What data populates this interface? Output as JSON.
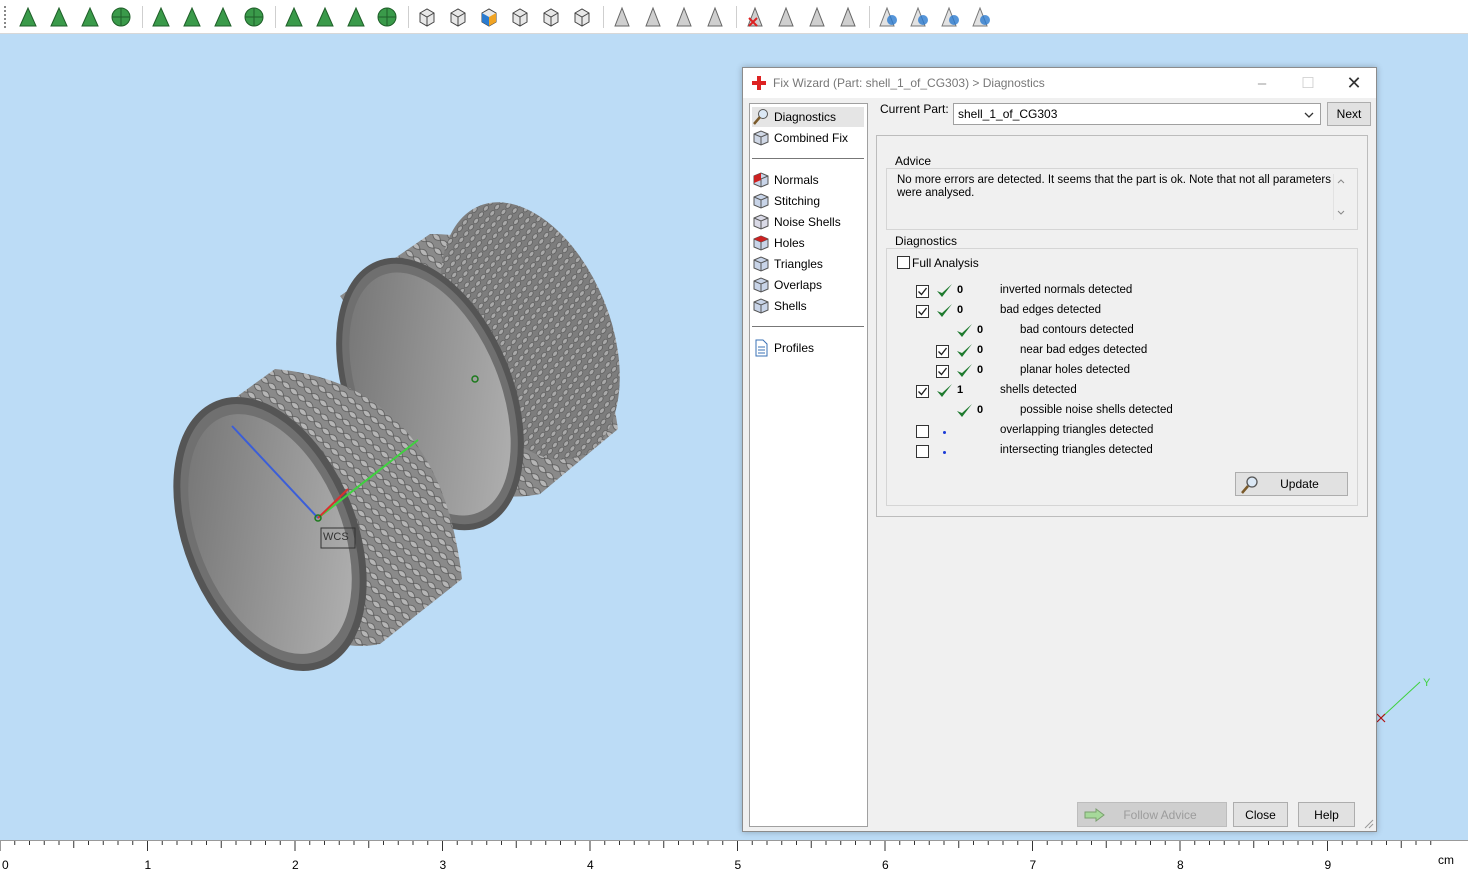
{
  "toolbar": {
    "icons": [
      "select-arrow-icon",
      "select-surface-icon",
      "select-edge-icon",
      "select-shell-icon",
      "rectangle-select-icon",
      "lasso-select-icon",
      "curve-select-icon",
      "mesh-select-icon",
      "grow-select-icon",
      "triangle-select-icon",
      "sphere-select-icon",
      "brush-select-icon",
      "view-front-icon",
      "view-back-icon",
      "view-left-icon",
      "view-right-icon",
      "view-top-icon",
      "view-iso-icon",
      "measure-icon",
      "cut-icon",
      "fill-icon",
      "analyze-icon",
      "delete-icon",
      "extrude-icon",
      "offset-icon",
      "smooth-icon",
      "hide-icon",
      "unhide-icon",
      "info-icon",
      "settings-icon"
    ]
  },
  "viewport": {
    "wcs_label": "WCS",
    "axis_y_label": "Y"
  },
  "ruler": {
    "labels": [
      "0",
      "1",
      "2",
      "3",
      "4",
      "5",
      "6",
      "7",
      "8",
      "9"
    ],
    "unit": "cm"
  },
  "dialog": {
    "title": "Fix Wizard (Part: shell_1_of_CG303) > Diagnostics",
    "nav": {
      "top": [
        {
          "label": "Diagnostics",
          "icon": "magnifier-icon",
          "selected": true
        },
        {
          "label": "Combined Fix",
          "icon": "combined-fix-icon"
        }
      ],
      "middle": [
        {
          "label": "Normals",
          "icon": "normals-icon"
        },
        {
          "label": "Stitching",
          "icon": "stitching-icon"
        },
        {
          "label": "Noise Shells",
          "icon": "noise-shells-icon"
        },
        {
          "label": "Holes",
          "icon": "holes-icon"
        },
        {
          "label": "Triangles",
          "icon": "triangles-icon"
        },
        {
          "label": "Overlaps",
          "icon": "overlaps-icon"
        },
        {
          "label": "Shells",
          "icon": "shells-icon"
        }
      ],
      "bottom": [
        {
          "label": "Profiles",
          "icon": "profiles-icon"
        }
      ]
    },
    "current_part_label": "Current Part:",
    "current_part_value": "shell_1_of_CG303",
    "next_label": "Next",
    "advice_title": "Advice",
    "advice_text": "No more errors are detected. It seems that the part is ok. Note that not all parameters were analysed.",
    "diagnostics_title": "Diagnostics",
    "full_analysis_label": "Full Analysis",
    "full_analysis_checked": false,
    "rows": [
      {
        "checkbox": true,
        "checked": true,
        "status": "ok",
        "count": "0",
        "label": "inverted normals detected",
        "indent": 0
      },
      {
        "checkbox": true,
        "checked": true,
        "status": "ok",
        "count": "0",
        "label": "bad edges detected",
        "indent": 0
      },
      {
        "checkbox": false,
        "checked": false,
        "status": "ok",
        "count": "0",
        "label": "bad contours detected",
        "indent": 1
      },
      {
        "checkbox": true,
        "checked": true,
        "status": "ok",
        "count": "0",
        "label": "near bad edges detected",
        "indent": 1
      },
      {
        "checkbox": true,
        "checked": true,
        "status": "ok",
        "count": "0",
        "label": "planar holes detected",
        "indent": 1
      },
      {
        "checkbox": true,
        "checked": true,
        "status": "ok",
        "count": "1",
        "label": "shells detected",
        "indent": 0
      },
      {
        "checkbox": false,
        "checked": false,
        "status": "ok",
        "count": "0",
        "label": "possible noise shells detected",
        "indent": 1
      },
      {
        "checkbox": true,
        "checked": false,
        "status": "pending",
        "count": "",
        "label": "overlapping triangles detected",
        "indent": 0
      },
      {
        "checkbox": true,
        "checked": false,
        "status": "pending",
        "count": "",
        "label": "intersecting triangles detected",
        "indent": 0
      }
    ],
    "update_label": "Update",
    "follow_advice_label": "Follow Advice",
    "close_label": "Close",
    "help_label": "Help"
  },
  "colors": {
    "viewport_bg": "#bcdcf6",
    "check_green": "#1e7a2e",
    "dot_blue": "#1a3ad6"
  }
}
